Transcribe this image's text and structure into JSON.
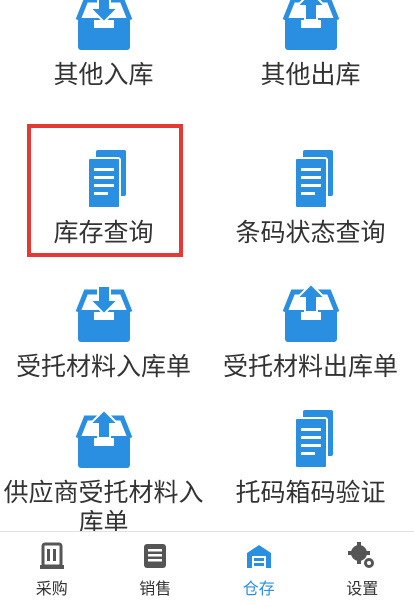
{
  "colors": {
    "icon_blue": "#2a8fe0",
    "highlight": "#e53935",
    "tab_inactive": "#333333",
    "tab_active": "#2a8fe0"
  },
  "grid": {
    "items": [
      {
        "label": "其他入库",
        "icon": "tray-down-icon"
      },
      {
        "label": "其他出库",
        "icon": "tray-up-icon"
      },
      {
        "label": "库存查询",
        "icon": "document-icon",
        "highlighted": true
      },
      {
        "label": "条码状态查询",
        "icon": "document-icon"
      },
      {
        "label": "受托材料入库单",
        "icon": "tray-down-icon"
      },
      {
        "label": "受托材料出库单",
        "icon": "tray-up-icon"
      },
      {
        "label": "供应商受托材料入库单",
        "icon": "tray-up-icon"
      },
      {
        "label": "托码箱码验证",
        "icon": "document-icon"
      }
    ]
  },
  "tabbar": {
    "active": "仓存",
    "tabs": [
      {
        "label": "采购",
        "icon": "ledger-icon"
      },
      {
        "label": "销售",
        "icon": "receipt-icon"
      },
      {
        "label": "仓存",
        "icon": "warehouse-icon"
      },
      {
        "label": "设置",
        "icon": "gears-icon"
      }
    ]
  }
}
